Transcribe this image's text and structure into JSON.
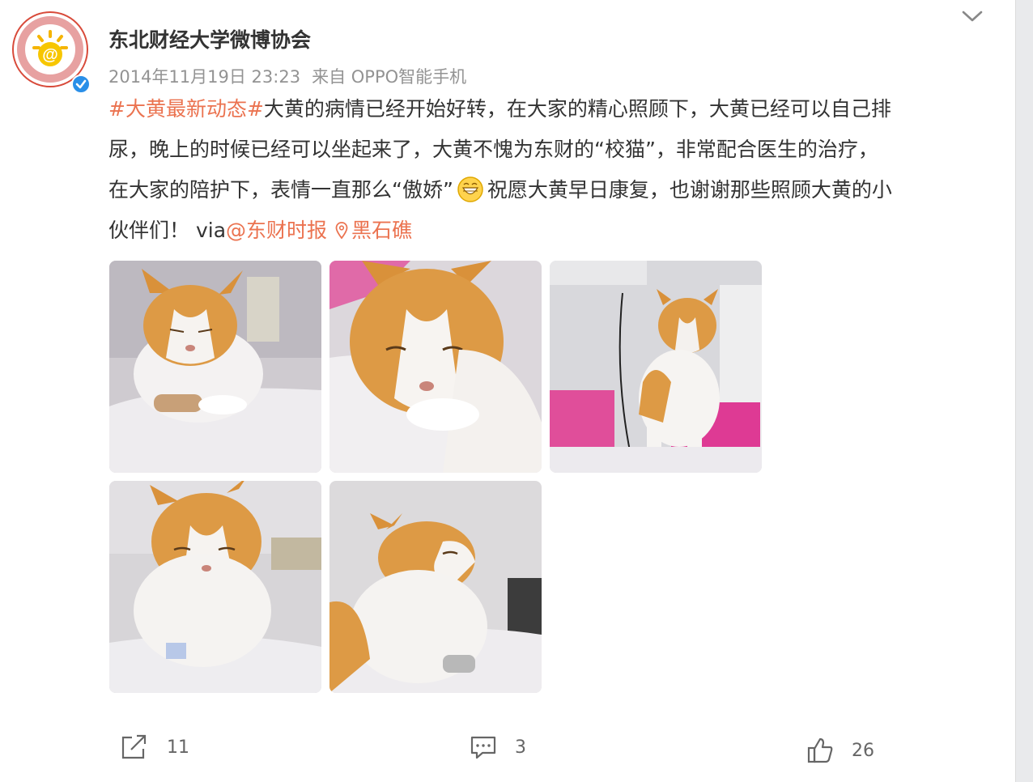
{
  "post": {
    "user_name": "东北财经大学微博协会",
    "date": "2014年11月19日 23:23",
    "source": "来自 OPPO智能手机",
    "text": {
      "hashtag": "#大黄最新动态#",
      "line1": "大黄的病情已经开始好转，在大家的精心照顾下，大黄已经可以自己排",
      "line2": "尿，晚上的时候已经可以坐起来了，大黄不愧为东财的“校猫”，非常配合医生的治疗，",
      "line3a": "在大家的陪护下，表情一直那么“傲娇”",
      "line3b": "祝愿大黄早日康复，也谢谢那些照顾大黄的小",
      "line4a": "伙伴们！ via",
      "mention": "@东财时报",
      "location": "黑石礁"
    },
    "images": [
      {
        "name": "cat-photo-1",
        "icon": "cat-lying-on-bed"
      },
      {
        "name": "cat-photo-2",
        "icon": "cat-closeup-resting"
      },
      {
        "name": "cat-photo-3",
        "icon": "cat-sitting-on-pink-blanket"
      },
      {
        "name": "cat-photo-4",
        "icon": "cat-sitting-with-iv"
      },
      {
        "name": "cat-photo-5",
        "icon": "cat-looking-up"
      }
    ]
  },
  "actions": {
    "repost_count": "11",
    "comment_count": "3",
    "like_count": "26"
  },
  "colors": {
    "accent": "#eb7350",
    "verified": "#2a8fe8",
    "text": "#333333",
    "meta": "#939393"
  }
}
